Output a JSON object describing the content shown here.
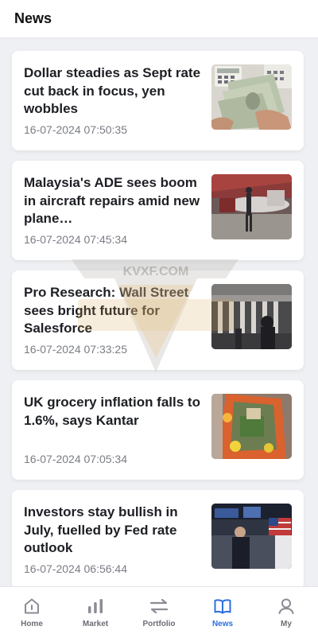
{
  "header": {
    "title": "News"
  },
  "articles": [
    {
      "title": "Dollar steadies as Sept rate cut back in focus, yen wobbles",
      "time": "16-07-2024 07:50:35",
      "image": "currency-calculator-photo"
    },
    {
      "title": "Malaysia's ADE sees boom in aircraft repairs amid new plane…",
      "time": "16-07-2024 07:45:34",
      "image": "aircraft-hangar-photo"
    },
    {
      "title": "Pro Research: Wall Street sees bright future for Salesforce",
      "time": "16-07-2024 07:33:25",
      "image": "nyse-building-photo"
    },
    {
      "title": "UK grocery inflation falls to 1.6%, says Kantar",
      "time": "16-07-2024 07:05:34",
      "image": "grocery-bag-photo"
    },
    {
      "title": "Investors stay bullish in July, fuelled by Fed rate outlook",
      "time": "16-07-2024 06:56:44",
      "image": "trading-floor-photo"
    }
  ],
  "watermark": {
    "text": "KVXF.COM"
  },
  "tabbar": {
    "active": "News",
    "active_color": "#2d6fe0",
    "items": [
      {
        "label": "Home",
        "icon": "home-icon"
      },
      {
        "label": "Market",
        "icon": "bar-chart-icon"
      },
      {
        "label": "Portfolio",
        "icon": "exchange-icon"
      },
      {
        "label": "News",
        "icon": "book-icon"
      },
      {
        "label": "My",
        "icon": "user-icon"
      }
    ]
  }
}
